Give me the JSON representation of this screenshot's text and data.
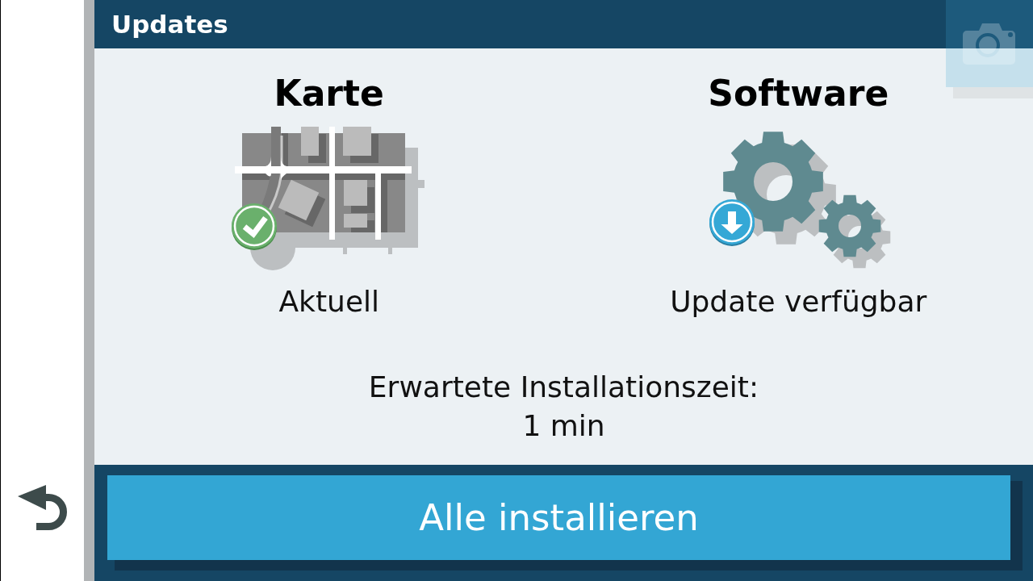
{
  "header": {
    "title": "Updates"
  },
  "items": [
    {
      "kind": "map",
      "title": "Karte",
      "status": "Aktuell",
      "update_available": false
    },
    {
      "kind": "software",
      "title": "Software",
      "status": "Update verfügbar",
      "update_available": true
    }
  ],
  "install_time": {
    "label": "Erwartete Installationszeit:",
    "value": "1 min"
  },
  "install_button": {
    "label": "Alle installieren"
  }
}
